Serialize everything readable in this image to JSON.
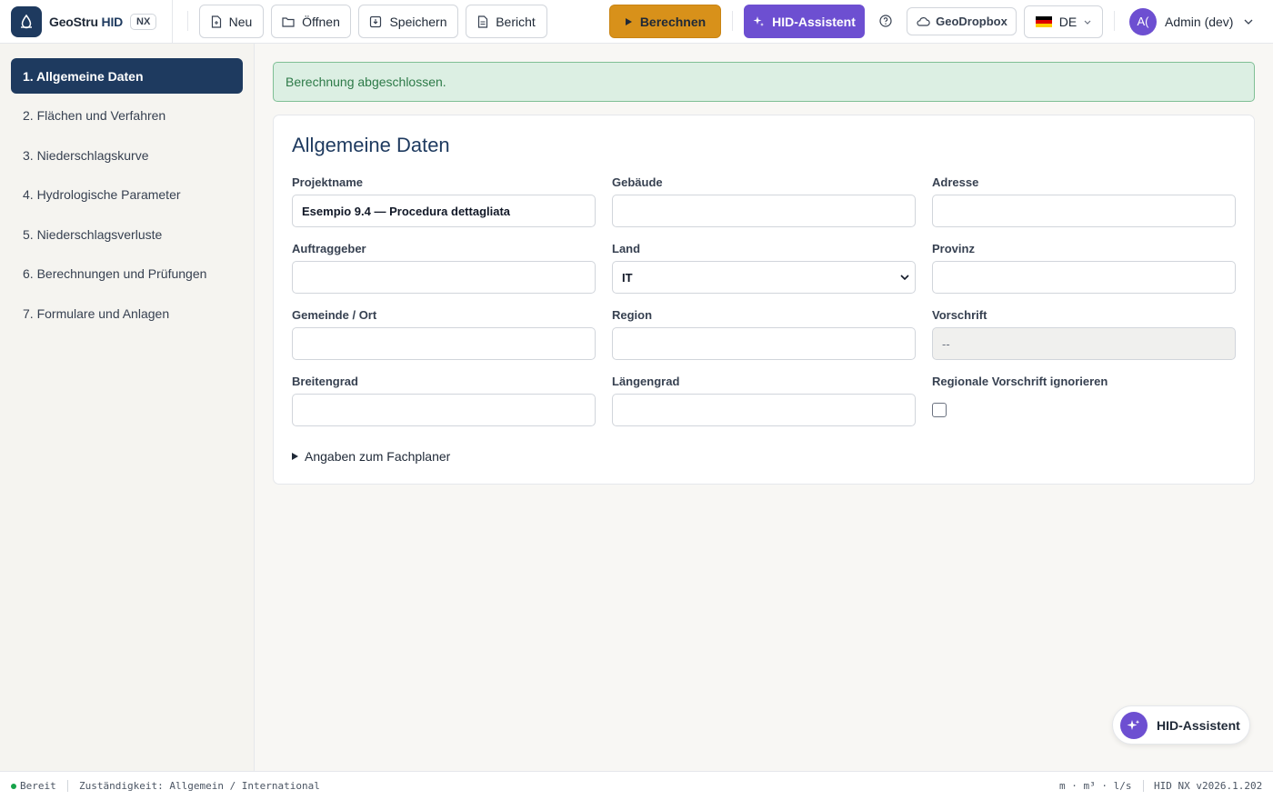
{
  "header": {
    "brand": {
      "name_prefix": "GeoStru",
      "name_accent": "HID",
      "badge": "NX"
    },
    "toolbar": {
      "new_label": "Neu",
      "open_label": "Öffnen",
      "save_label": "Speichern",
      "report_label": "Bericht"
    },
    "calculate_label": "Berechnen",
    "assistant_label": "HID-Assistent",
    "cloud_label": "GeoDropbox",
    "language": {
      "code": "DE",
      "flag_colors": [
        "#000000",
        "#dd0000",
        "#ffce00"
      ]
    },
    "user": {
      "initials": "A(",
      "name": "Admin (dev)"
    }
  },
  "sidebar": {
    "items": [
      {
        "label": "1. Allgemeine Daten",
        "active": true
      },
      {
        "label": "2. Flächen und Verfahren"
      },
      {
        "label": "3. Niederschlagskurve"
      },
      {
        "label": "4. Hydrologische Parameter"
      },
      {
        "label": "5. Niederschlagsverluste"
      },
      {
        "label": "6. Berechnungen und Prüfungen"
      },
      {
        "label": "7. Formulare und Anlagen"
      }
    ]
  },
  "alert": {
    "message": "Berechnung abgeschlossen."
  },
  "form": {
    "title": "Allgemeine Daten",
    "fields": {
      "project_name": {
        "label": "Projektname",
        "value": "Esempio 9.4 — Procedura dettagliata"
      },
      "building": {
        "label": "Gebäude",
        "value": ""
      },
      "address": {
        "label": "Adresse",
        "value": ""
      },
      "client": {
        "label": "Auftraggeber",
        "value": ""
      },
      "country": {
        "label": "Land",
        "value": "IT"
      },
      "province": {
        "label": "Provinz",
        "value": ""
      },
      "municipality": {
        "label": "Gemeinde / Ort",
        "value": ""
      },
      "region": {
        "label": "Region",
        "value": ""
      },
      "regulation": {
        "label": "Vorschrift",
        "value": "--"
      },
      "latitude": {
        "label": "Breitengrad",
        "value": ""
      },
      "longitude": {
        "label": "Längengrad",
        "value": ""
      },
      "ignore_regional": {
        "label": "Regionale Vorschrift ignorieren",
        "checked": false
      }
    },
    "disclosure_label": "Angaben zum Fachplaner"
  },
  "floating_assistant": {
    "label": "HID-Assistent"
  },
  "statusbar": {
    "status": "Bereit",
    "jurisdiction": "Zuständigkeit: Allgemein / International",
    "units": "m · m³ · l/s",
    "version": "HID NX v2026.1.202"
  },
  "colors": {
    "primary": "#1e3a5f",
    "accent_orange": "#d8911a",
    "accent_purple": "#6d4fd1",
    "success": "#16a34a"
  }
}
